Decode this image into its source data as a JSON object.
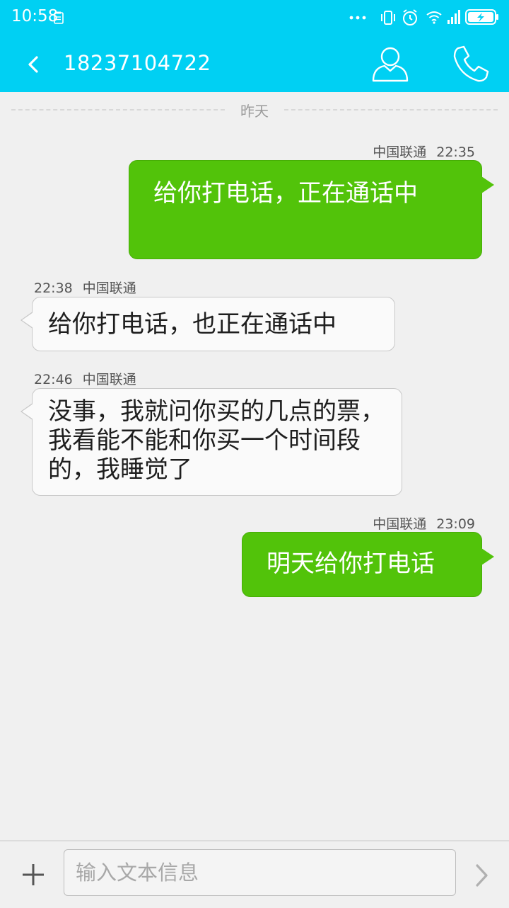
{
  "status_bar": {
    "time": "10:58",
    "icons": [
      "clipboard-icon",
      "more-dots-icon",
      "vibrate-icon",
      "alarm-icon",
      "wifi-icon",
      "signal-icon",
      "battery-charging-icon"
    ]
  },
  "header": {
    "title": "18237104722",
    "back_icon": "chevron-left-icon",
    "contact_icon": "person-icon",
    "call_icon": "phone-icon"
  },
  "date_divider": "昨天",
  "messages": [
    {
      "direction": "outgoing",
      "carrier": "中国联通",
      "time": "22:35",
      "text": "给你打电话，正在通话中"
    },
    {
      "direction": "incoming",
      "carrier": "中国联通",
      "time": "22:38",
      "text": "给你打电话，也正在通话中"
    },
    {
      "direction": "incoming",
      "carrier": "中国联通",
      "time": "22:46",
      "text": "没事，我就问你买的几点的票，我看能不能和你买一个时间段的，我睡觉了"
    },
    {
      "direction": "outgoing",
      "carrier": "中国联通",
      "time": "23:09",
      "text": "明天给你打电话"
    }
  ],
  "composer": {
    "placeholder": "输入文本信息",
    "value": "",
    "add_icon": "plus-icon",
    "send_icon": "chevron-right-icon"
  },
  "colors": {
    "header_bg": "#00d0f3",
    "outgoing_bubble": "#52c30a",
    "incoming_bubble": "#fafafa",
    "background": "#f0f0f0"
  }
}
